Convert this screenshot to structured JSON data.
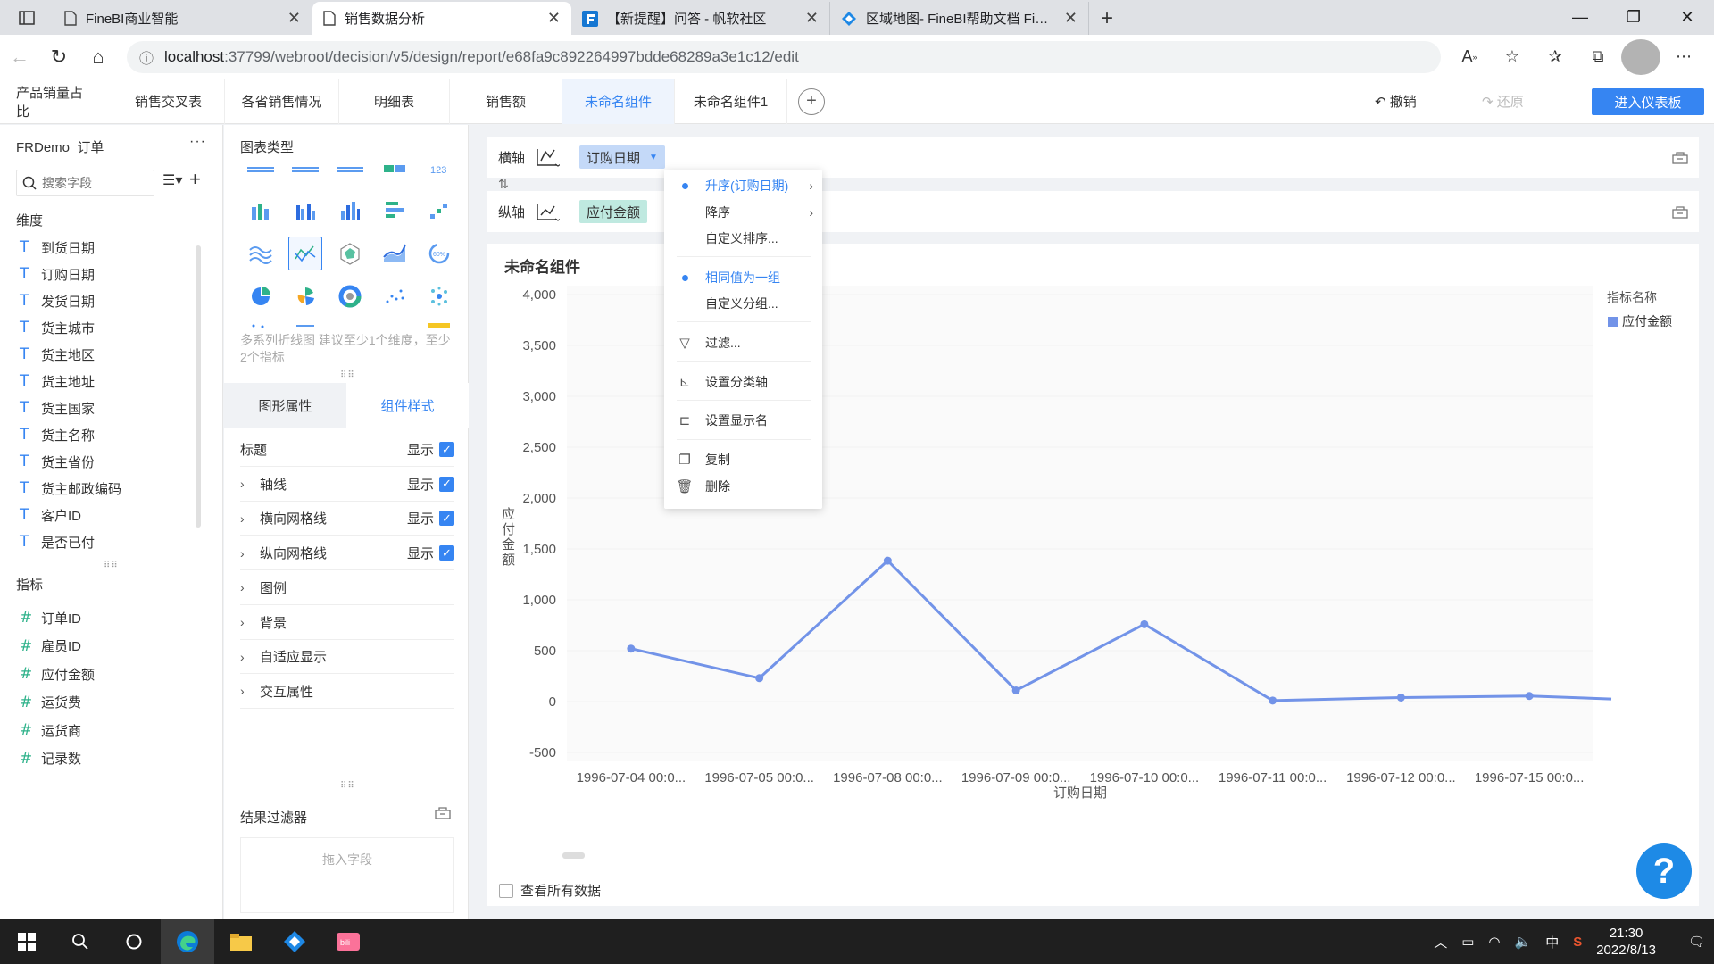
{
  "browser": {
    "tabs": [
      {
        "title": "FineBI商业智能",
        "active": false
      },
      {
        "title": "销售数据分析",
        "active": true
      },
      {
        "title": "【新提醒】问答 - 帆软社区",
        "active": false
      },
      {
        "title": "区域地图- FineBI帮助文档 FineBI",
        "active": false
      }
    ],
    "url_host": "localhost",
    "url_path": ":37799/webroot/decision/v5/design/report/e68fa9c892264997bdde68289a3e1c12/edit"
  },
  "app_tabs": [
    "产品销量占比",
    "销售交叉表",
    "各省销售情况",
    "明细表",
    "销售额",
    "未命名组件",
    "未命名组件1"
  ],
  "active_app_tab": 5,
  "toolbar": {
    "undo": "撤销",
    "redo": "还原",
    "enter_dashboard": "进入仪表板"
  },
  "dataset": {
    "title": "FRDemo_订单",
    "search_placeholder": "搜索字段",
    "dimension_label": "维度",
    "dimensions": [
      "到货日期",
      "订购日期",
      "发货日期",
      "货主城市",
      "货主地区",
      "货主地址",
      "货主国家",
      "货主名称",
      "货主省份",
      "货主邮政编码",
      "客户ID",
      "是否已付"
    ],
    "metric_label": "指标",
    "metrics": [
      "订单ID",
      "雇员ID",
      "应付金额",
      "运货费",
      "运货商",
      "记录数"
    ]
  },
  "config": {
    "chart_type_title": "图表类型",
    "chart_type_hint": "多系列折线图 建议至少1个维度，至少2个指标",
    "subtabs": [
      "图形属性",
      "组件样式"
    ],
    "active_subtab": 1,
    "props": [
      {
        "label": "标题",
        "expandable": false,
        "show": "显示"
      },
      {
        "label": "轴线",
        "expandable": true,
        "show": "显示"
      },
      {
        "label": "横向网格线",
        "expandable": true,
        "show": "显示"
      },
      {
        "label": "纵向网格线",
        "expandable": true,
        "show": "显示"
      },
      {
        "label": "图例",
        "expandable": true,
        "show": ""
      },
      {
        "label": "背景",
        "expandable": true,
        "show": ""
      },
      {
        "label": "自适应显示",
        "expandable": true,
        "show": ""
      },
      {
        "label": "交互属性",
        "expandable": true,
        "show": ""
      }
    ],
    "result_filter_title": "结果过滤器",
    "drop_placeholder": "拖入字段"
  },
  "axes": {
    "x_label": "横轴",
    "x_field": "订购日期",
    "y_label": "纵轴",
    "y_field": "应付金额"
  },
  "menu": {
    "items": [
      {
        "label": "升序(订购日期)",
        "selected": true,
        "submenu": true,
        "icon": ""
      },
      {
        "label": "降序",
        "selected": false,
        "submenu": true,
        "icon": ""
      },
      {
        "label": "自定义排序...",
        "selected": false,
        "submenu": false,
        "icon": ""
      },
      {
        "label": "相同值为一组",
        "selected": true,
        "submenu": false,
        "icon": ""
      },
      {
        "label": "自定义分组...",
        "selected": false,
        "submenu": false,
        "icon": ""
      },
      {
        "label": "过滤...",
        "selected": false,
        "submenu": false,
        "icon": "filter-icon"
      },
      {
        "label": "设置分类轴",
        "selected": false,
        "submenu": false,
        "icon": "category-axis-icon"
      },
      {
        "label": "设置显示名",
        "selected": false,
        "submenu": false,
        "icon": "rename-icon"
      },
      {
        "label": "复制",
        "selected": false,
        "submenu": false,
        "icon": "copy-icon"
      },
      {
        "label": "删除",
        "selected": false,
        "submenu": false,
        "icon": "trash-icon"
      }
    ]
  },
  "chart_data": {
    "type": "line",
    "title": "未命名组件",
    "xlabel": "订购日期",
    "ylabel": "应付金额",
    "categories": [
      "1996-07-04 00:0...",
      "1996-07-05 00:0...",
      "1996-07-08 00:0...",
      "1996-07-09 00:0...",
      "1996-07-10 00:0...",
      "1996-07-11 00:0...",
      "1996-07-12 00:0...",
      "1996-07-15 00:0..."
    ],
    "series": [
      {
        "name": "应付金额",
        "values": [
          520,
          230,
          1385,
          110,
          760,
          10,
          40,
          55
        ],
        "tail_value": 25
      }
    ],
    "yticks": [
      4000,
      3500,
      3000,
      2500,
      2000,
      1500,
      1000,
      500,
      0,
      -500
    ],
    "ylim": [
      -500,
      4000
    ],
    "legend_title": "指标名称",
    "legend_position": "top-right",
    "color": "#7293e8",
    "grid": true
  },
  "view_all_label": "查看所有数据",
  "help_label": "?",
  "taskbar": {
    "time": "21:30",
    "date": "2022/8/13",
    "ime": "中"
  }
}
